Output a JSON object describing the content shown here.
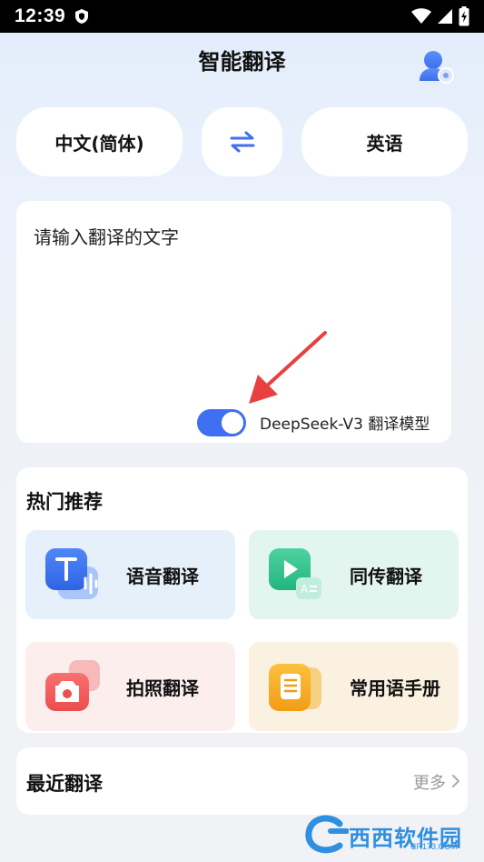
{
  "status_bar": {
    "time": "12:39",
    "icons": [
      "shield-icon",
      "wifi-icon",
      "signal-icon",
      "battery-charging-icon"
    ]
  },
  "header": {
    "title": "智能翻译",
    "avatar_icon": "user-settings-icon"
  },
  "language_bar": {
    "source": "中文(简体)",
    "swap_icon": "swap-arrows-icon",
    "target": "英语"
  },
  "input": {
    "placeholder": "请输入翻译的文字",
    "model_toggle_on": true,
    "model_label": "DeepSeek-V3 翻译模型"
  },
  "hot": {
    "title": "热门推荐",
    "items": [
      {
        "label": "语音翻译",
        "icon": "text-voice-icon"
      },
      {
        "label": "同传翻译",
        "icon": "play-translate-icon"
      },
      {
        "label": "拍照翻译",
        "icon": "camera-icon"
      },
      {
        "label": "常用语手册",
        "icon": "phrasebook-icon"
      }
    ]
  },
  "recent": {
    "title": "最近翻译",
    "more": "更多"
  },
  "watermark": {
    "main": "西西软件园",
    "sub": "CR173.COM"
  },
  "colors": {
    "accent": "#3f6ff2",
    "voice_bg": "#e6f0fb",
    "simul_bg": "#e3f5ef",
    "photo_bg": "#fdeeee",
    "phrase_bg": "#fbf1e1",
    "annotation_arrow": "#e8403f"
  }
}
